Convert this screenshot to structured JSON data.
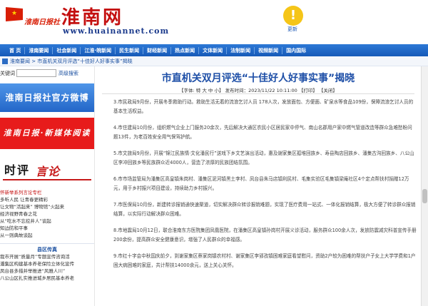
{
  "header": {
    "logo_text": "淮南日报社",
    "site_name": "淮南网",
    "site_url": "www.huainannet.com",
    "update_label": "更新"
  },
  "nav": {
    "items": [
      "首 页",
      "淮南要闻",
      "社会新闻",
      "江淮·皖新闻",
      "民生新闻",
      "财经新闻",
      "热点新闻",
      "文体新闻",
      "法制新闻",
      "视频新闻",
      "国内国际"
    ]
  },
  "breadcrumb": {
    "text": "淮南要闻 > 市直机关双月评选“十佳好人好事实事”揭晓"
  },
  "sidebar": {
    "search_label": "关键词",
    "search_button": "高级搜索",
    "weibo_banner": "淮南日报社官方微博",
    "rbxmt_banner": "淮南日报·新媒体阅读",
    "shiping_big": "时评",
    "shiping_red": "言论",
    "items": [
      "怀新举系列言论专栏",
      "多听人民 让青春更精彩",
      "让文物“活起来” 博物馆“火起来",
      "经济视野青春之花",
      "从“吃水不忘挖井人”谈起",
      "知边防和平事",
      "从一则典故谈起"
    ],
    "section_title": "县区传真",
    "district_items": [
      "我市开展“质量月”专题宣传咨询活",
      "潘集区构建基本养老保险立体化宣传",
      "凤台县多措并举推进“风雅人川”",
      "八公山区扎实推进城乡居民基本养老"
    ]
  },
  "article": {
    "title": "市直机关双月评选“十佳好人好事实事”揭晓",
    "meta": "【字体: 特 大 中 小】 发布时间：2023/11/22 10:11:00  【打印】 【关闭】",
    "paragraphs": [
      "3.市民政局9月份，开展冬季救助行动。救助生活无着的流浪乞讨人员 178人次，发放面包、方便面、矿泉水等食品109份，保障流浪乞讨人员的基本生活权益。",
      "4.市住建局10月份，组织燃气企业上门服务20余次，先后解决大通区农民小区居民家中停气、南山名郡用户家中燃气管道改造等群众急难愁盼问题13件，为老百姓安全用气保驾护航。",
      "5.市文旅局9月份，开展“锦江民族情·文化潘民行”送戏下乡文艺演出活动，惠及谢家集区孤堆回族乡、寿县陶店回族乡、潘集古沟回族乡、八公山区李冲回族乡等民族群众近4000人，营造了浓厚的民族团结氛围。",
      "6.市市场监管局为潘集区高皇镇朱岗村、潘集区泥河镇黑土李村、凤台县朱马店镇利民村、毛集实验区毛集镇梁庵社区4个定点帮扶村捐赠12万元，用于乡村振兴项目建设，持续助力乡村振兴。",
      "7.市医保局10月份，新建转诊报销通快速渠道，切实解决群众转诊报销难题，实现了医疗费用一站式、一体化报销结算，极大方便了转诊群众报销结算，以实际行动解决群众困难。",
      "8.市地震局10月12日，联合淮南东方医院集团凤凰医院，在潘集区高皇镇孙岗村开展义诊活动，服务群众100余人次，发放防震减灾科普宣传手册200余份，提高群众安全健康意识，增强了人民群众的幸福感。",
      "9.市红十字会中秋国庆前夕，到谢家集区蔡家岗镇农村村、谢家集区李郢孜镇困难家庭看望慰问，资助2户较为困难的帮扶户子女上大学学费和1户困大病困难的家庭，共计帮扶14000余元，送上关心关怀。"
    ]
  }
}
